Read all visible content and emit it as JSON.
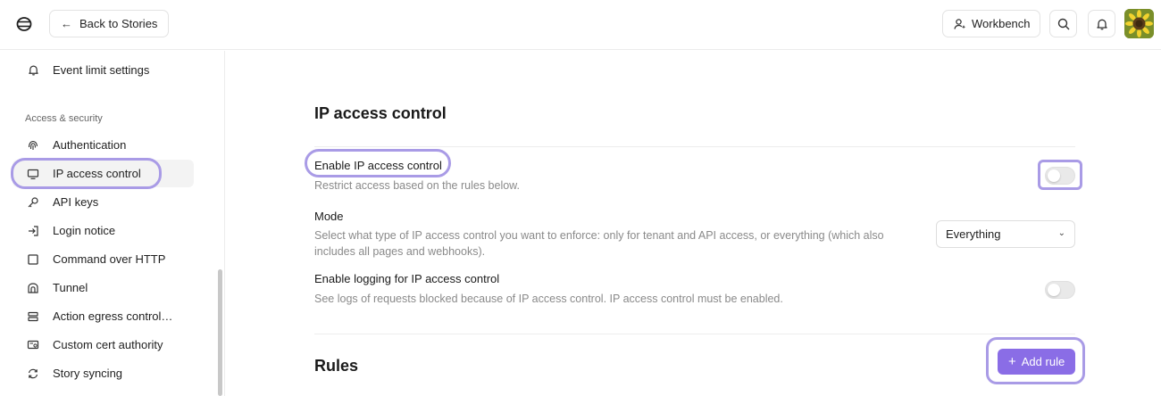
{
  "header": {
    "back_label": "Back to Stories",
    "workbench_label": "Workbench",
    "avatar_color": "#7a8f2a"
  },
  "sidebar": {
    "items_top": [
      {
        "label": "Event limit settings",
        "icon": "bell-icon"
      }
    ],
    "section_label": "Access & security",
    "items": [
      {
        "label": "Authentication",
        "icon": "fingerprint-icon"
      },
      {
        "label": "IP access control",
        "icon": "monitor-icon",
        "active": true
      },
      {
        "label": "API keys",
        "icon": "key-icon"
      },
      {
        "label": "Login notice",
        "icon": "login-icon"
      },
      {
        "label": "Command over HTTP",
        "icon": "square-icon"
      },
      {
        "label": "Tunnel",
        "icon": "tunnel-icon"
      },
      {
        "label": "Action egress control…",
        "icon": "server-icon"
      },
      {
        "label": "Custom cert authority",
        "icon": "certificate-icon"
      },
      {
        "label": "Story syncing",
        "icon": "sync-icon"
      }
    ]
  },
  "main": {
    "title": "IP access control",
    "enable": {
      "title": "Enable IP access control",
      "desc": "Restrict access based on the rules below.",
      "enabled": false
    },
    "mode": {
      "title": "Mode",
      "desc_line1": "Select what type of IP access control you want to enforce: only for tenant and API access, or everything (which also",
      "desc_line2": "includes all pages and webhooks).",
      "value": "Everything"
    },
    "logging": {
      "title": "Enable logging for IP access control",
      "desc": "See logs of requests blocked because of IP access control. IP access control must be enabled.",
      "enabled": false
    },
    "rules_title": "Rules",
    "add_rule_label": "Add rule"
  },
  "colors": {
    "accent": "#8a6de6",
    "highlight": "#a99be6"
  }
}
